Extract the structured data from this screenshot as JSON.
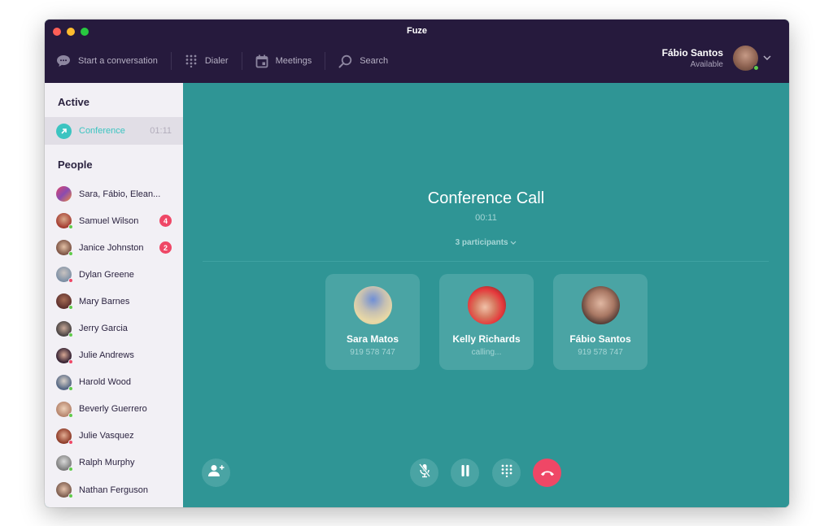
{
  "window": {
    "title": "Fuze"
  },
  "nav": {
    "items": [
      {
        "label": "Start a conversation",
        "icon": "chat-bubble-icon"
      },
      {
        "label": "Dialer",
        "icon": "dialpad-icon"
      },
      {
        "label": "Meetings",
        "icon": "calendar-icon"
      },
      {
        "label": "Search",
        "icon": "search-icon"
      }
    ]
  },
  "user": {
    "name": "Fábio Santos",
    "status": "Available",
    "status_color": "#5fcc4a"
  },
  "sidebar": {
    "active_title": "Active",
    "active_item": {
      "label": "Conference",
      "time": "01:11"
    },
    "people_title": "People",
    "people": [
      {
        "name": "Sara, Fábio, Elean...",
        "badge": "",
        "status": "",
        "avatar": "linear-gradient(135deg,#e0466a 0%,#8a4bb0 50%,#f08a3c 100%)"
      },
      {
        "name": "Samuel Wilson",
        "badge": "4",
        "status": "online",
        "avatar": "radial-gradient(circle at 50% 40%,#d9a88a,#a33a2f 70%,#5b2a25)"
      },
      {
        "name": "Janice Johnston",
        "badge": "2",
        "status": "online",
        "avatar": "radial-gradient(circle at 50% 45%,#e3c0a5,#7a5142 70%,#2e211c)"
      },
      {
        "name": "Dylan Greene",
        "badge": "",
        "status": "busy",
        "avatar": "radial-gradient(circle at 50% 40%,#c9c3c0,#7c8fa5 70%,#4f5d73)"
      },
      {
        "name": "Mary Barnes",
        "badge": "",
        "status": "online",
        "avatar": "radial-gradient(circle at 50% 40%,#a56b54,#5d2f2c 70%,#2e1a1c)"
      },
      {
        "name": "Jerry Garcia",
        "badge": "",
        "status": "online",
        "avatar": "radial-gradient(circle at 50% 45%,#c7a898,#454040 70%,#1f1d1d)"
      },
      {
        "name": "Julie Andrews",
        "badge": "",
        "status": "busy",
        "avatar": "radial-gradient(circle at 50% 45%,#d7a894,#3a2636 65%,#1c1420)"
      },
      {
        "name": "Harold Wood",
        "badge": "",
        "status": "online",
        "avatar": "radial-gradient(circle at 50% 40%,#d8d0c8,#4f6280 70%,#e6e2dc)"
      },
      {
        "name": "Beverly Guerrero",
        "badge": "",
        "status": "online",
        "avatar": "radial-gradient(circle at 50% 45%,#edd0b8,#b4826a 70%,#6a4a3c)"
      },
      {
        "name": "Julie Vasquez",
        "badge": "",
        "status": "busy",
        "avatar": "radial-gradient(circle at 50% 45%,#e2ad93,#92402d 65%,#4e2019)"
      },
      {
        "name": "Ralph Murphy",
        "badge": "",
        "status": "online",
        "avatar": "radial-gradient(circle at 50% 40%,#d8d8d8,#7b7b7b 70%,#3c3c3c)"
      },
      {
        "name": "Nathan Ferguson",
        "badge": "",
        "status": "online",
        "avatar": "radial-gradient(circle at 50% 45%,#e4c1ab,#7a5a4c 70%,#3c2b27)"
      }
    ]
  },
  "call": {
    "title": "Conference Call",
    "elapsed": "00:11",
    "participants_label": "3 participants",
    "participants": [
      {
        "name": "Sara Matos",
        "sub": "919 578 747",
        "avatar": "radial-gradient(circle at 50% 35%,#6f8fd6 0%,#c6c0b2 40%,#e8d8a6 70%,#d9c998 100%)"
      },
      {
        "name": "Kelly Richards",
        "sub": "calling...",
        "avatar": "radial-gradient(circle at 45% 55%,#f0c2a9 0%,#d7775e 35%,#e6383c 60%,#4a2a22 100%)"
      },
      {
        "name": "Fábio Santos",
        "sub": "919 578 747",
        "avatar": "radial-gradient(circle at 50% 45%,#e0b7a2 0%,#a97864 45%,#4f3832 75%,#e2e0e0 100%)"
      }
    ],
    "controls": [
      "add-participant",
      "mute",
      "hold",
      "dialpad",
      "hang-up"
    ]
  },
  "colors": {
    "online": "#5fcc4a",
    "busy": "#ef4766",
    "accent": "#3cc4c1",
    "call_bg": "#2f9595",
    "topbar": "#261a3d"
  }
}
